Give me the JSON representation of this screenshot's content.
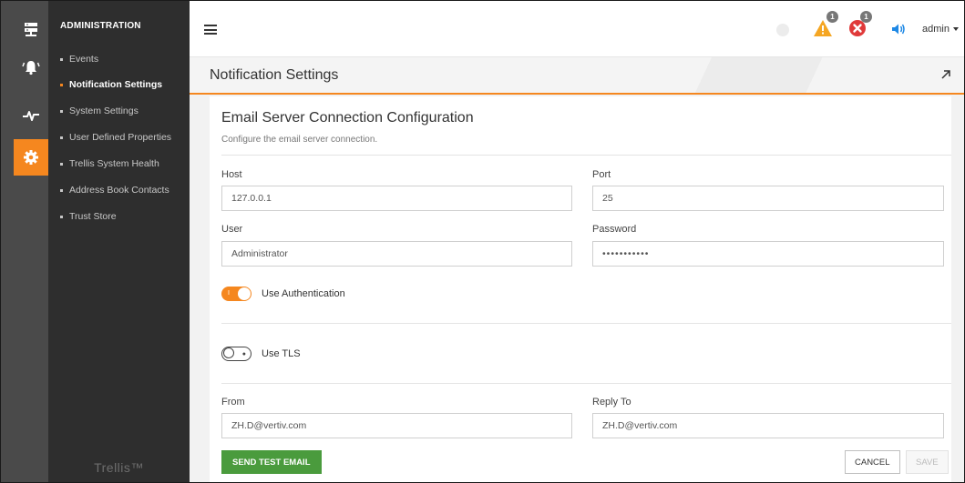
{
  "rail": {
    "items": [
      {
        "name": "server-icon",
        "active": false
      },
      {
        "name": "alarm-bell-icon",
        "active": false
      },
      {
        "name": "pulse-icon",
        "active": false
      },
      {
        "name": "gear-icon",
        "active": true
      }
    ]
  },
  "sidebar": {
    "heading": "ADMINISTRATION",
    "items": [
      {
        "label": "Events",
        "active": false
      },
      {
        "label": "Notification Settings",
        "active": true
      },
      {
        "label": "System Settings",
        "active": false
      },
      {
        "label": "User Defined Properties",
        "active": false
      },
      {
        "label": "Trellis System Health",
        "active": false
      },
      {
        "label": "Address Book Contacts",
        "active": false
      },
      {
        "label": "Trust Store",
        "active": false
      }
    ],
    "brand": "Trellis™"
  },
  "topbar": {
    "warning_count": "1",
    "error_count": "1",
    "user": "admin"
  },
  "page": {
    "title": "Notification Settings"
  },
  "form": {
    "title": "Email Server Connection Configuration",
    "subtitle": "Configure the email server connection.",
    "host_label": "Host",
    "host_value": "127.0.0.1",
    "port_label": "Port",
    "port_value": "25",
    "user_label": "User",
    "user_value": "Administrator",
    "password_label": "Password",
    "password_value": "•••••••••••",
    "use_auth_label": "Use Authentication",
    "use_auth_on": true,
    "use_tls_label": "Use TLS",
    "use_tls_on": false,
    "from_label": "From",
    "from_value": "ZH.D@vertiv.com",
    "reply_to_label": "Reply To",
    "reply_to_value": "ZH.D@vertiv.com"
  },
  "actions": {
    "send_test": "SEND TEST EMAIL",
    "cancel": "CANCEL",
    "save": "SAVE"
  },
  "colors": {
    "accent": "#f5871f",
    "rail_bg": "#4a4a4a",
    "sidebar_bg": "#2e2e2e",
    "success_button": "#4a9b3d",
    "warning": "#f5a623",
    "error": "#e03a3a",
    "info_blue": "#1e88e5"
  }
}
